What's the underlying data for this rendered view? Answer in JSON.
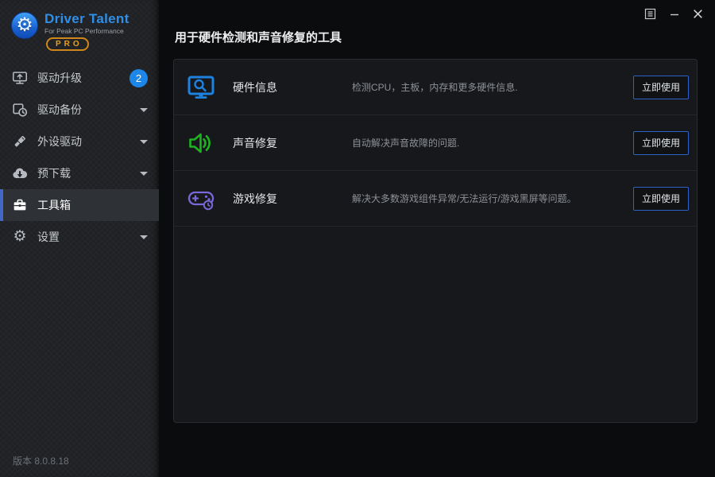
{
  "logo": {
    "title": "Driver Talent",
    "subtitle": "For Peak PC Performance",
    "badge": "PRO"
  },
  "window": {
    "controls": [
      "menu-icon",
      "minimize-icon",
      "close-icon"
    ]
  },
  "sidebar": {
    "items": [
      {
        "label": "驱动升级",
        "icon": "monitor-upgrade-icon",
        "badge": "2"
      },
      {
        "label": "驱动备份",
        "icon": "backup-clock-icon",
        "expandable": true
      },
      {
        "label": "外设驱动",
        "icon": "usb-drive-icon",
        "expandable": true
      },
      {
        "label": "预下载",
        "icon": "cloud-download-icon",
        "expandable": true
      },
      {
        "label": "工具箱",
        "icon": "toolbox-icon",
        "selected": true
      },
      {
        "label": "设置",
        "icon": "gear-icon",
        "expandable": true
      }
    ],
    "version": "版本 8.0.8.18"
  },
  "main": {
    "title": "用于硬件检测和声音修复的工具",
    "tools": [
      {
        "name": "硬件信息",
        "desc": "检测CPU，主板，内存和更多硬件信息.",
        "button": "立即使用",
        "icon": "hardware-monitor-icon",
        "color": "#1e82e0"
      },
      {
        "name": "声音修复",
        "desc": "自动解决声音故障的问题.",
        "button": "立即使用",
        "icon": "speaker-icon",
        "color": "#1fb31f"
      },
      {
        "name": "游戏修复",
        "desc": "解决大多数游戏组件异常/无法运行/游戏黑屏等问题。",
        "button": "立即使用",
        "icon": "gamepad-repair-icon",
        "color": "#7a68d8"
      }
    ]
  },
  "colors": {
    "accent_blue": "#1d87e9",
    "selected_bar": "#4168c6",
    "button_border": "#2d62c8",
    "sidebar_bg": "#1f2124",
    "panel_bg": "#17181b",
    "pro_orange": "#e8a01e"
  }
}
